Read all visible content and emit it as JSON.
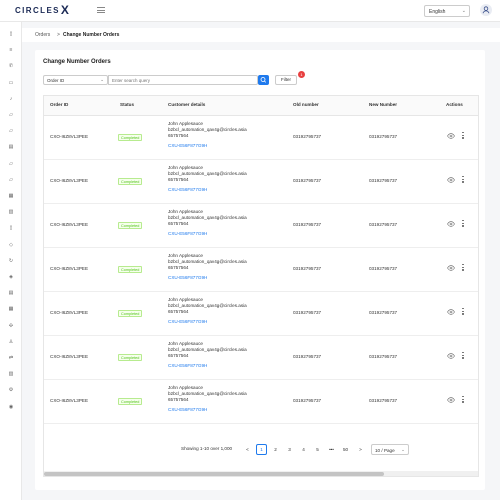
{
  "header": {
    "logo_text": "CIRCLES",
    "logo_mark": "X",
    "language": "English",
    "icons": {
      "menu": "hamburger-icon",
      "user": "user-icon",
      "chevron": "chevron-down-icon"
    }
  },
  "sidebar": {
    "icons": [
      "document-icon",
      "feed-icon",
      "phone-icon",
      "card-icon",
      "bell-icon",
      "folder-icon",
      "folder-icon",
      "inbox-icon",
      "folder-icon",
      "folder-icon",
      "box-icon",
      "building-icon",
      "file-icon",
      "tag-icon",
      "refresh-icon",
      "stack-icon",
      "notes-icon",
      "report-icon",
      "puzzle-icon",
      "user-add-icon",
      "merge-icon",
      "chart-icon",
      "gear-icon",
      "settings-icon"
    ]
  },
  "breadcrumb": {
    "items": [
      "Orders",
      "Change Number Orders"
    ],
    "separator": ">"
  },
  "page": {
    "title": "Change Number Orders",
    "search_field_select": "Order ID",
    "search_placeholder": "Enter search query",
    "filter_label": "Filter",
    "filter_badge_count": "1"
  },
  "table": {
    "columns": [
      "Order ID",
      "Status",
      "Customer details",
      "Old number",
      "New Number",
      "Actions"
    ],
    "rows": [
      {
        "order_id": "CXO-I6Z8VL3PEE",
        "status": "Completed",
        "customer_name": "John Applesauce",
        "customer_email": "b2bcl_automation_qav4g@circles.asia",
        "customer_phone": "65757564",
        "customer_id": "CXU-E56F877G9H",
        "old_number": "03192795737",
        "new_number": "03192795737"
      },
      {
        "order_id": "CXO-I6Z8VL3PEE",
        "status": "Completed",
        "customer_name": "John Applesauce",
        "customer_email": "b2bcl_automation_qav4g@circles.asia",
        "customer_phone": "65757564",
        "customer_id": "CXU-E56F877G9H",
        "old_number": "03192795737",
        "new_number": "03192795737"
      },
      {
        "order_id": "CXO-I6Z8VL3PEE",
        "status": "Completed",
        "customer_name": "John Applesauce",
        "customer_email": "b2bcl_automation_qav4g@circles.asia",
        "customer_phone": "65757564",
        "customer_id": "CXU-E56F877G9H",
        "old_number": "03192795737",
        "new_number": "03192795737"
      },
      {
        "order_id": "CXO-I6Z8VL3PEE",
        "status": "Completed",
        "customer_name": "John Applesauce",
        "customer_email": "b2bcl_automation_qav4g@circles.asia",
        "customer_phone": "65757564",
        "customer_id": "CXU-E56F877G9H",
        "old_number": "03192795737",
        "new_number": "03192795737"
      },
      {
        "order_id": "CXO-I6Z8VL3PEE",
        "status": "Completed",
        "customer_name": "John Applesauce",
        "customer_email": "b2bcl_automation_qav4g@circles.asia",
        "customer_phone": "65757564",
        "customer_id": "CXU-E56F877G9H",
        "old_number": "03192795737",
        "new_number": "03192795737"
      },
      {
        "order_id": "CXO-I6Z8VL3PEE",
        "status": "Completed",
        "customer_name": "John Applesauce",
        "customer_email": "b2bcl_automation_qav4g@circles.asia",
        "customer_phone": "65757564",
        "customer_id": "CXU-E56F877G9H",
        "old_number": "03192795737",
        "new_number": "03192795737"
      },
      {
        "order_id": "CXO-I6Z8VL3PEE",
        "status": "Completed",
        "customer_name": "John Applesauce",
        "customer_email": "b2bcl_automation_qav4g@circles.asia",
        "customer_phone": "65757564",
        "customer_id": "CXU-E56F877G9H",
        "old_number": "03192795737",
        "new_number": "03192795737"
      }
    ]
  },
  "pagination": {
    "summary": "Showing 1-10 over 1,000",
    "prev": "<",
    "pages": [
      "1",
      "2",
      "3",
      "4",
      "5"
    ],
    "ellipsis": "•••",
    "last_page": "50",
    "next": ">",
    "page_size": "10 / Page",
    "current": "1"
  },
  "colors": {
    "accent": "#1f7aed",
    "badge_red": "#e84040",
    "completed_green": "#52c41a",
    "brand_navy": "#1b2a55"
  }
}
